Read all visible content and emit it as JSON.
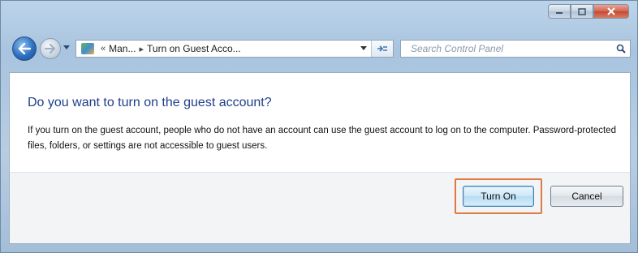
{
  "window": {
    "caption_icons": [
      "minimize-icon",
      "maximize-icon",
      "close-icon"
    ]
  },
  "navbar": {
    "breadcrumb": [
      "Man...",
      "Turn on Guest Acco..."
    ],
    "breadcrumb_prefix": "«",
    "search_placeholder": "Search Control Panel"
  },
  "dialog": {
    "heading": "Do you want to turn on the guest account?",
    "body": "If you turn on the guest account, people who do not have an account can use the guest account to log on to the computer. Password-protected files, folders, or settings are not accessible to guest users.",
    "turn_on_label": "Turn On",
    "cancel_label": "Cancel"
  },
  "colors": {
    "heading": "#1e3f8a",
    "highlight": "#e07a45"
  }
}
